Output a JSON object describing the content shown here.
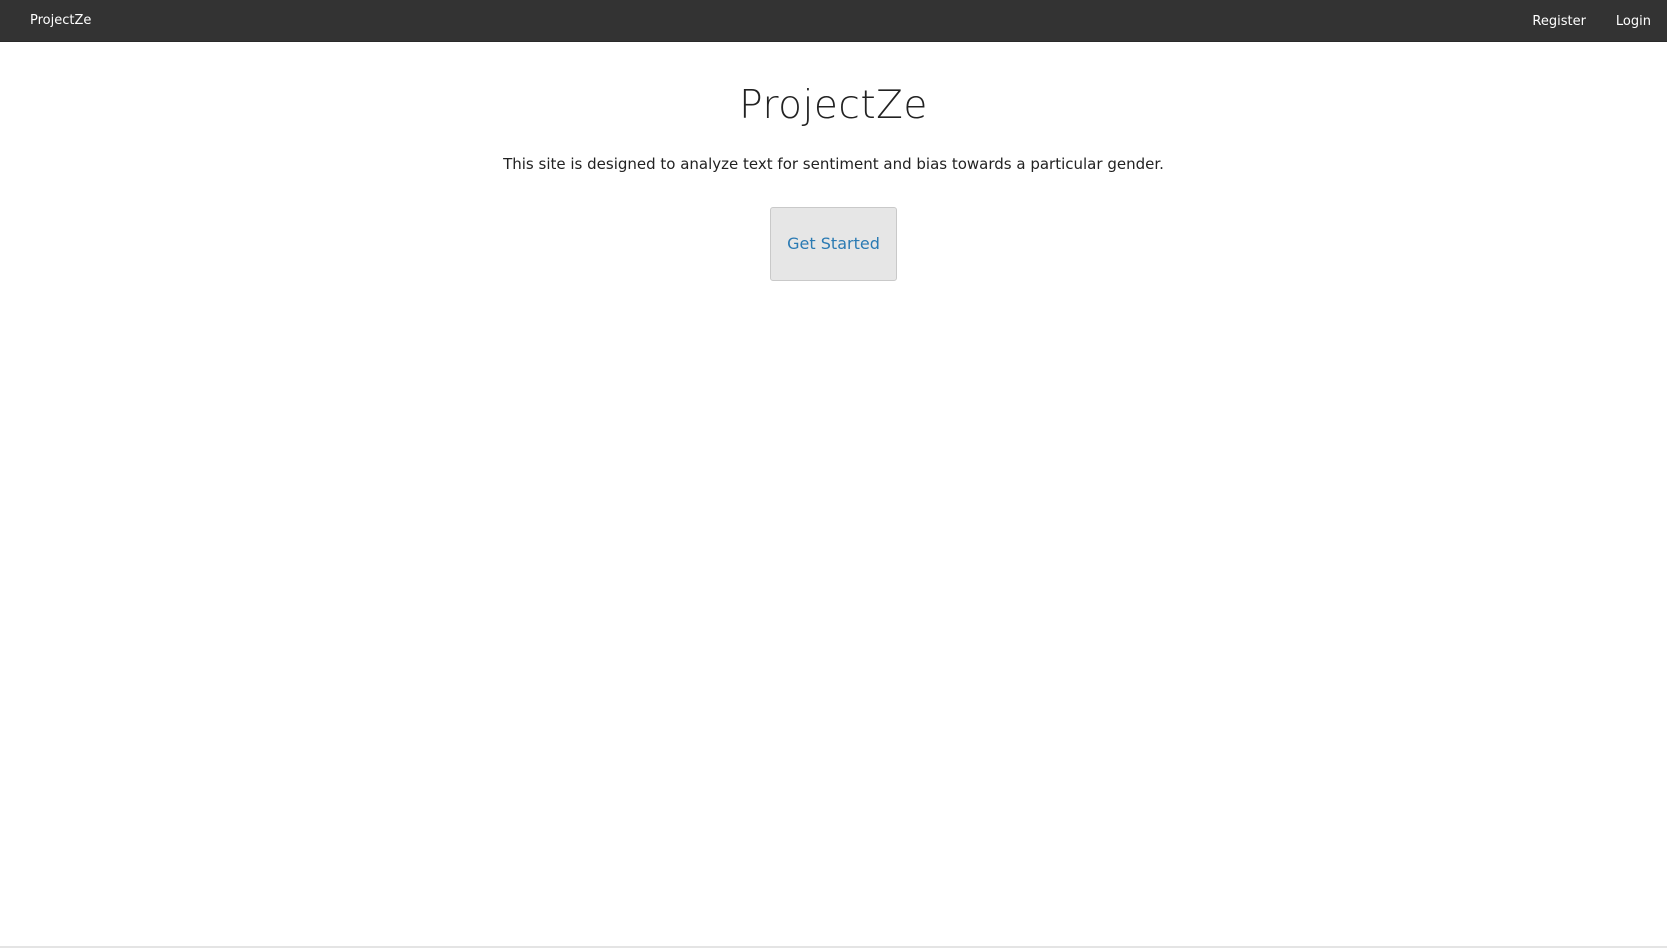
{
  "navbar": {
    "brand": "ProjectZe",
    "links": [
      {
        "label": "Register"
      },
      {
        "label": "Login"
      }
    ]
  },
  "hero": {
    "title": "ProjectZe",
    "description": "This site is designed to analyze text for sentiment and bias towards a particular gender.",
    "cta_label": "Get Started"
  },
  "colors": {
    "navbar_bg": "#333333",
    "button_bg": "#e6e6e6",
    "button_text": "#2a7ab3",
    "text": "#222222"
  }
}
